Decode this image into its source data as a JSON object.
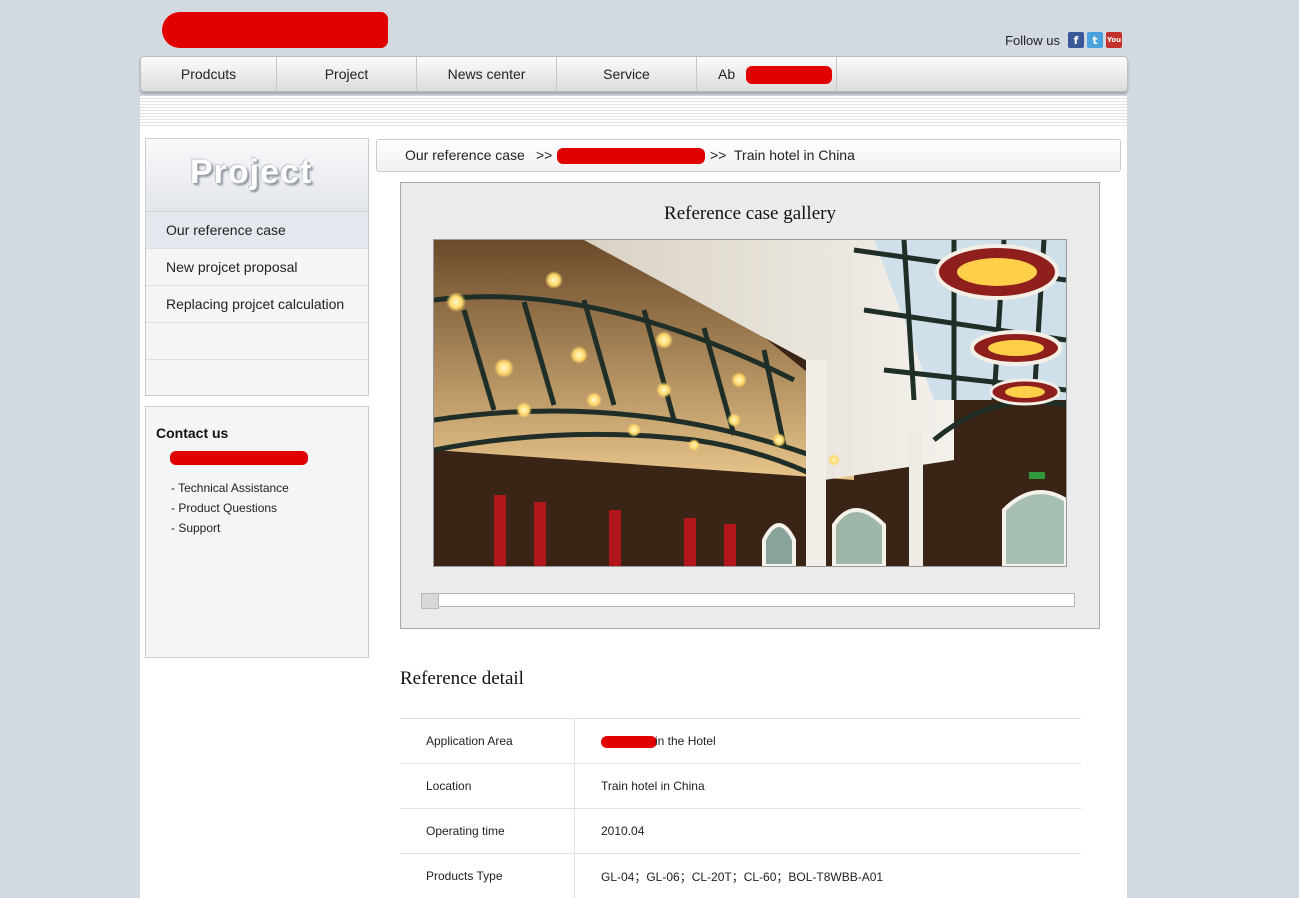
{
  "header": {
    "follow_label": "Follow us",
    "social_icons": [
      "facebook-icon",
      "twitter-icon",
      "youtube-icon"
    ]
  },
  "nav": {
    "items": [
      "Prodcuts",
      "Project",
      "News center",
      "Service",
      "Ab"
    ]
  },
  "sidebar": {
    "title": "Project",
    "items": [
      "Our reference case",
      "New projcet proposal",
      "Replacing projcet calculation",
      "",
      ""
    ]
  },
  "contact": {
    "title": "Contact us",
    "lines": [
      "- Technical Assistance",
      "- Product Questions",
      "- Support"
    ]
  },
  "breadcrumb": {
    "first": "Our reference case",
    "sep1": ">>",
    "sep2": ">>",
    "current": "Train hotel in China"
  },
  "gallery": {
    "title": "Reference case gallery"
  },
  "detail": {
    "title": "Reference detail",
    "rows": [
      {
        "label": "Application Area",
        "value": "in the Hotel"
      },
      {
        "label": "Location",
        "value": "Train hotel in China"
      },
      {
        "label": "Operating time",
        "value": "2010.04"
      },
      {
        "label": "Products Type",
        "value": "GL-04；GL-06；CL-20T；CL-60；BOL-T8WBB-A01"
      }
    ]
  },
  "colors": {
    "background": "#d3d9e0",
    "redaction": "#e00000"
  }
}
